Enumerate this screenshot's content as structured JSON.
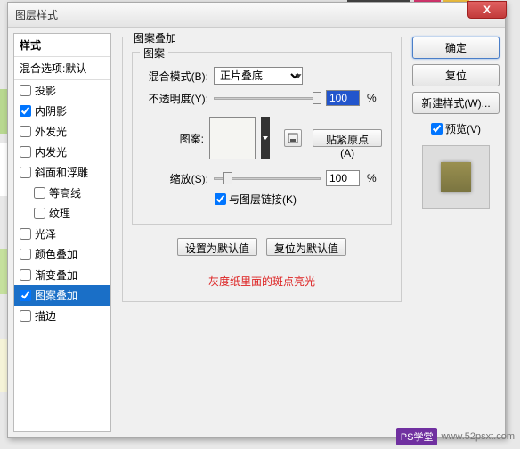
{
  "dialog": {
    "title": "图层样式"
  },
  "sidebar": {
    "header": "样式",
    "sub": "混合选项:默认",
    "items": [
      {
        "label": "投影",
        "checked": false
      },
      {
        "label": "内阴影",
        "checked": true
      },
      {
        "label": "外发光",
        "checked": false
      },
      {
        "label": "内发光",
        "checked": false
      },
      {
        "label": "斜面和浮雕",
        "checked": false
      },
      {
        "label": "等高线",
        "checked": false,
        "indent": true
      },
      {
        "label": "纹理",
        "checked": false,
        "indent": true
      },
      {
        "label": "光泽",
        "checked": false
      },
      {
        "label": "颜色叠加",
        "checked": false
      },
      {
        "label": "渐变叠加",
        "checked": false
      },
      {
        "label": "图案叠加",
        "checked": true,
        "active": true
      },
      {
        "label": "描边",
        "checked": false
      }
    ]
  },
  "main": {
    "section_title": "图案叠加",
    "group_title": "图案",
    "blend_label": "混合模式(B):",
    "blend_value": "正片叠底",
    "opacity_label": "不透明度(Y):",
    "opacity_value": "100",
    "pct": "%",
    "pattern_label": "图案:",
    "snap_btn": "贴紧原点(A)",
    "scale_label": "缩放(S):",
    "scale_value": "100",
    "link_label": "与图层链接(K)",
    "default_btn": "设置为默认值",
    "reset_btn": "复位为默认值",
    "note": "灰度纸里面的斑点亮光"
  },
  "right": {
    "ok": "确定",
    "cancel": "复位",
    "newstyle": "新建样式(W)...",
    "preview": "预览(V)"
  },
  "watermark": {
    "badge": "PS学堂",
    "url": "www.52psxt.com"
  }
}
